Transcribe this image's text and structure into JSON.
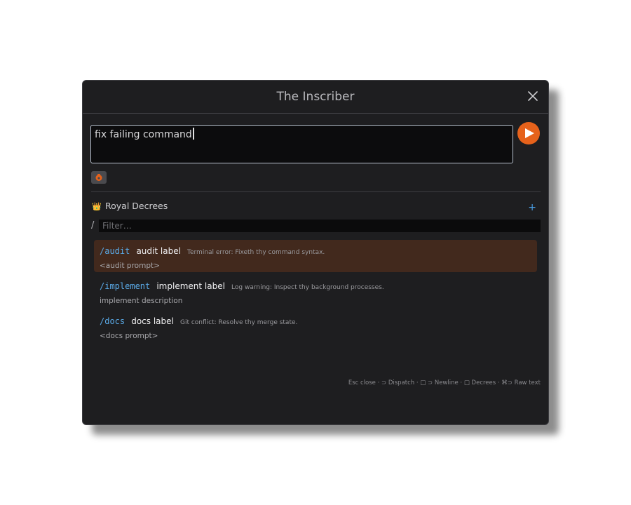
{
  "window": {
    "title": "The Inscriber",
    "close_icon": "close-icon"
  },
  "composer": {
    "text": "fix failing command",
    "send_icon": "send-icon",
    "attach_icon": "puzzle-icon"
  },
  "section": {
    "title": "Royal Decrees",
    "icon": "crown-icon",
    "add_label": "+"
  },
  "filter": {
    "prefix": "/",
    "placeholder": "Filter…"
  },
  "commands": [
    {
      "cmd": "/audit",
      "label": "audit label",
      "hint": "Terminal error: Fixeth thy command syntax.",
      "desc": "<audit prompt>",
      "selected": true
    },
    {
      "cmd": "/implement",
      "label": "implement label",
      "hint": "Log warning: Inspect thy background processes.",
      "desc": "implement description",
      "selected": false
    },
    {
      "cmd": "/docs",
      "label": "docs label",
      "hint": "Git conflict: Resolve thy merge state.",
      "desc": "<docs prompt>",
      "selected": false
    }
  ],
  "footer": "Esc close · ⊃ Dispatch · □ ⊃ Newline · □ Decrees · ⌘⊃ Raw text",
  "colors": {
    "accent": "#e6621b",
    "command": "#5aa9e6",
    "selected_bg": "#42291d",
    "panel_bg": "#1e1e20"
  }
}
